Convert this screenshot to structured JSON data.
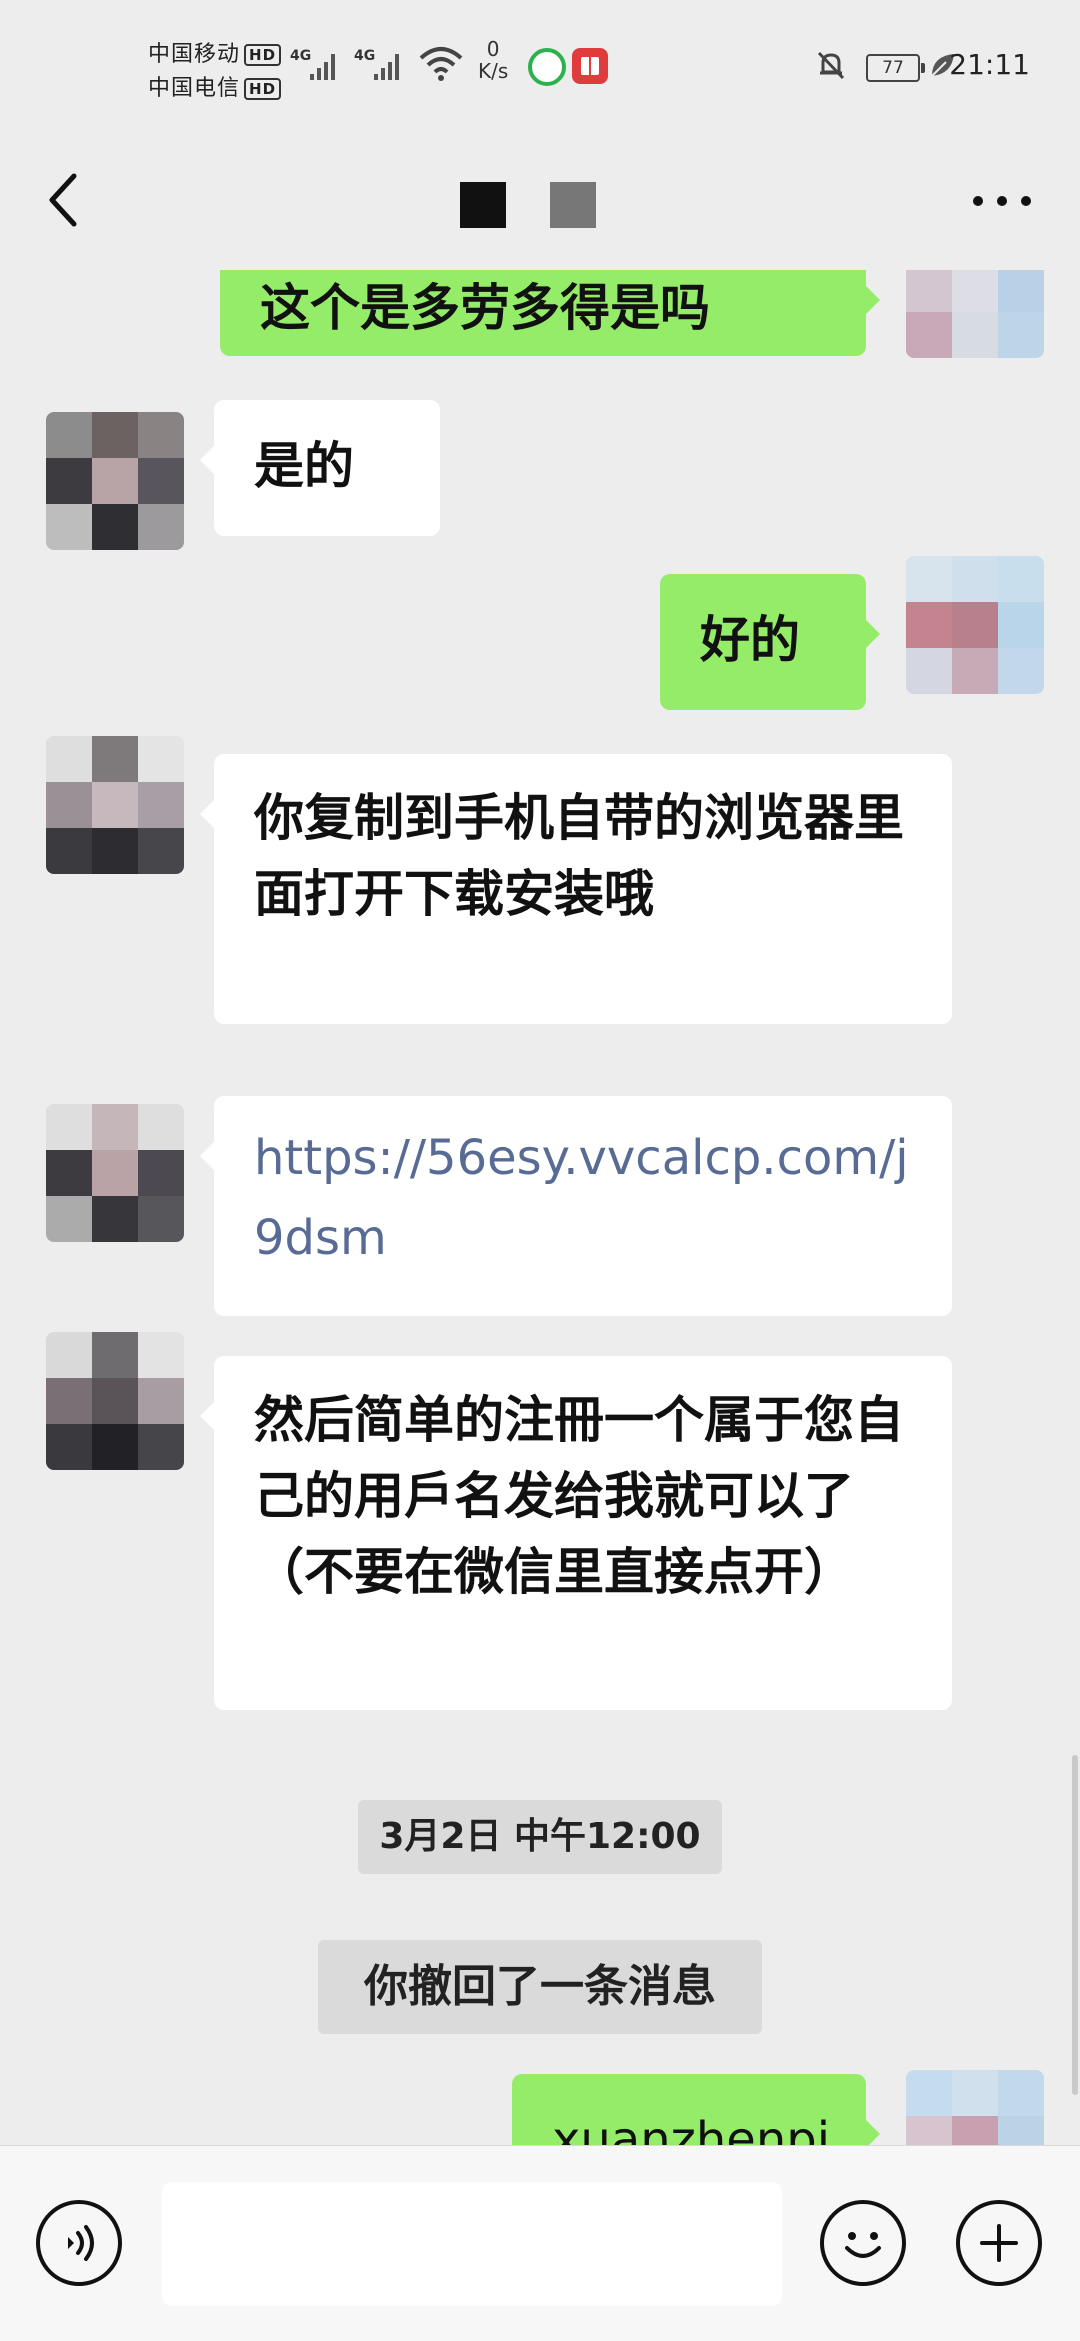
{
  "status_bar": {
    "carrier_1": "中国移动",
    "carrier_2": "中国电信",
    "hd_badge": "HD",
    "network_1": "4G",
    "network_2": "4G",
    "net_speed_value": "0",
    "net_speed_unit": "K/s",
    "battery_level": "77",
    "time": "21:11"
  },
  "header": {
    "more_icon_name": "more-dots-icon",
    "back_icon_name": "back-chevron-icon"
  },
  "messages": [
    {
      "side": "right",
      "text": "这个是多劳多得是吗"
    },
    {
      "side": "left",
      "text": "是的"
    },
    {
      "side": "right",
      "text": "好的"
    },
    {
      "side": "left",
      "text": "你复制到手机自带的浏览器里面打开下载安装哦"
    },
    {
      "side": "left",
      "text": "https://56esy.vvcalcp.com/j9dsm"
    },
    {
      "side": "left",
      "text": "然后简单的注冊一个属于您自己的用戶名发给我就可以了（不要在微信里直接点开）"
    },
    {
      "side": "center",
      "text": "3月2日 中午12:00"
    },
    {
      "side": "center",
      "text": "你撤回了一条消息"
    },
    {
      "side": "right",
      "text": "xuanzhenpi"
    }
  ],
  "input_bar": {
    "voice_icon_name": "voice-icon",
    "emoji_icon_name": "emoji-icon",
    "plus_icon_name": "plus-icon",
    "message_value": ""
  },
  "colors": {
    "background": "#ededed",
    "green_bubble": "#95ec69",
    "white_bubble": "#ffffff",
    "link": "#576b95"
  }
}
